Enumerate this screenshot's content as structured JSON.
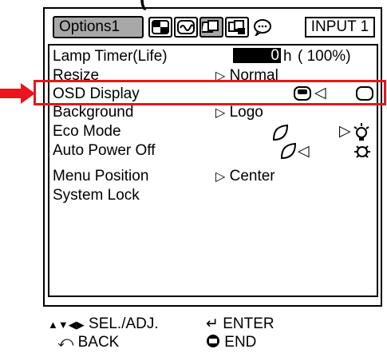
{
  "heading": "(",
  "tabs": {
    "active_label": "Options1",
    "icons": [
      "picture-tab-icon",
      "audio-tab-icon",
      "options1-tab-icon",
      "options2-tab-icon",
      "language-tab-icon"
    ],
    "input_label": "INPUT 1"
  },
  "menu": {
    "items": [
      {
        "label": "Lamp Timer(Life)"
      },
      {
        "label": "Resize",
        "value": "Normal"
      },
      {
        "label": "OSD Display"
      },
      {
        "label": "Background",
        "value": "Logo"
      },
      {
        "label": "Eco Mode"
      },
      {
        "label": "Auto Power Off"
      },
      {
        "label": "Menu Position",
        "value": "Center"
      },
      {
        "label": "System Lock"
      }
    ],
    "lamp_timer": {
      "hours": "0",
      "unit": "h",
      "life": "( 100%)"
    }
  },
  "highlight_color": "#e8141e",
  "footer": {
    "sel_adj": "SEL./ADJ.",
    "enter": "ENTER",
    "back": "BACK",
    "end": "END"
  }
}
